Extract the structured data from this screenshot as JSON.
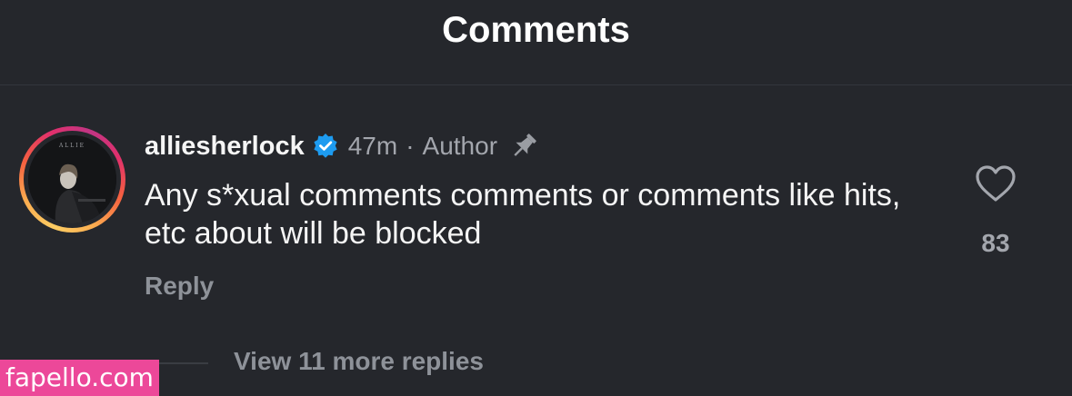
{
  "header": {
    "title": "Comments"
  },
  "comment": {
    "username": "alliesherlock",
    "verified": true,
    "time": "47m",
    "separator": "·",
    "role": "Author",
    "pinned": true,
    "text": "Any s*xual comments comments or comments like hits, etc about will be blocked",
    "reply_label": "Reply",
    "like_count": "83",
    "like_icon": "heart-outline-icon",
    "pin_icon": "pin-icon",
    "verified_icon": "verified-badge-icon",
    "avatar_text": "ALLIE",
    "view_replies_label": "View 11 more replies"
  },
  "colors": {
    "background": "#25272c",
    "verified": "#1d9bf0",
    "muted": "#a3a6ad",
    "watermark": "#ec4899"
  },
  "watermark": {
    "text": "fapello.com"
  }
}
